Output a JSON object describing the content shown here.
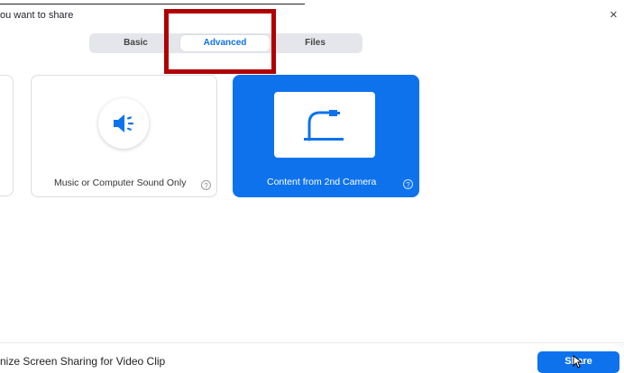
{
  "dialog": {
    "title": "ou want to share",
    "close_symbol": "×"
  },
  "tabs": [
    {
      "label": "Basic",
      "selected": false
    },
    {
      "label": "Advanced",
      "selected": true
    },
    {
      "label": "Files",
      "selected": false
    }
  ],
  "options": [
    {
      "label": "Music or Computer Sound Only",
      "help_symbol": "?",
      "icon": "speaker-icon",
      "selected": false
    },
    {
      "label": "Content from 2nd Camera",
      "help_symbol": "?",
      "icon": "document-camera-icon",
      "selected": true
    }
  ],
  "footer": {
    "optimize_label": "nize Screen Sharing for Video Clip",
    "share_label": "Share"
  },
  "colors": {
    "accent": "#0e72ed",
    "highlight": "#b00000"
  }
}
